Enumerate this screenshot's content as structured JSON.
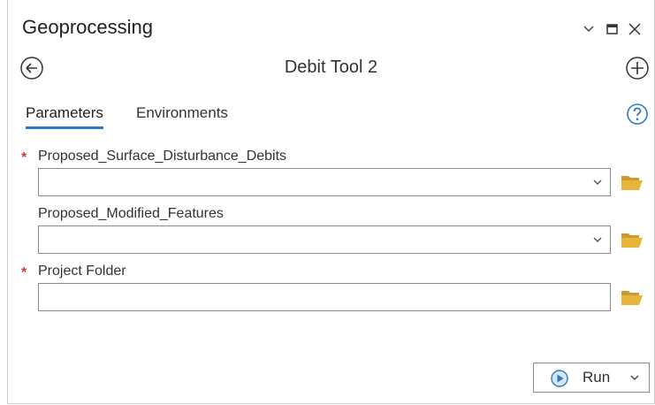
{
  "pane": {
    "title": "Geoprocessing"
  },
  "window_controls": {
    "options_icon": "chevron-down-icon",
    "maximize_icon": "maximize-icon",
    "close_icon": "close-icon"
  },
  "tool": {
    "name": "Debit Tool 2",
    "back_icon": "back-arrow-icon",
    "add_icon": "add-icon"
  },
  "tabs": [
    {
      "label": "Parameters",
      "active": true
    },
    {
      "label": "Environments",
      "active": false
    }
  ],
  "help_icon": "help-icon",
  "parameters": [
    {
      "label": "Proposed_Surface_Disturbance_Debits",
      "required": true,
      "value": "",
      "has_dropdown": true
    },
    {
      "label": "Proposed_Modified_Features",
      "required": false,
      "value": "",
      "has_dropdown": true
    },
    {
      "label": "Project Folder",
      "required": true,
      "value": "",
      "has_dropdown": false
    }
  ],
  "required_marker": "*",
  "run_button": {
    "label": "Run",
    "icon": "play-icon"
  },
  "colors": {
    "accent": "#2d7bc1",
    "required": "#c8402a",
    "folder": "#e8b53a"
  }
}
